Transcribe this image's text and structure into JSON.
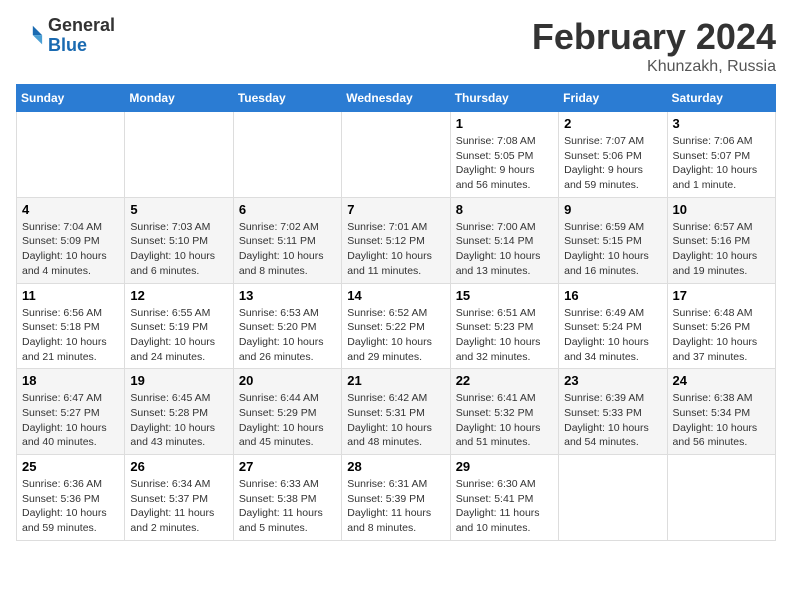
{
  "header": {
    "logo_line1": "General",
    "logo_line2": "Blue",
    "month_title": "February 2024",
    "location": "Khunzakh, Russia"
  },
  "weekdays": [
    "Sunday",
    "Monday",
    "Tuesday",
    "Wednesday",
    "Thursday",
    "Friday",
    "Saturday"
  ],
  "weeks": [
    [
      {
        "day": "",
        "info": ""
      },
      {
        "day": "",
        "info": ""
      },
      {
        "day": "",
        "info": ""
      },
      {
        "day": "",
        "info": ""
      },
      {
        "day": "1",
        "info": "Sunrise: 7:08 AM\nSunset: 5:05 PM\nDaylight: 9 hours and 56 minutes."
      },
      {
        "day": "2",
        "info": "Sunrise: 7:07 AM\nSunset: 5:06 PM\nDaylight: 9 hours and 59 minutes."
      },
      {
        "day": "3",
        "info": "Sunrise: 7:06 AM\nSunset: 5:07 PM\nDaylight: 10 hours and 1 minute."
      }
    ],
    [
      {
        "day": "4",
        "info": "Sunrise: 7:04 AM\nSunset: 5:09 PM\nDaylight: 10 hours and 4 minutes."
      },
      {
        "day": "5",
        "info": "Sunrise: 7:03 AM\nSunset: 5:10 PM\nDaylight: 10 hours and 6 minutes."
      },
      {
        "day": "6",
        "info": "Sunrise: 7:02 AM\nSunset: 5:11 PM\nDaylight: 10 hours and 8 minutes."
      },
      {
        "day": "7",
        "info": "Sunrise: 7:01 AM\nSunset: 5:12 PM\nDaylight: 10 hours and 11 minutes."
      },
      {
        "day": "8",
        "info": "Sunrise: 7:00 AM\nSunset: 5:14 PM\nDaylight: 10 hours and 13 minutes."
      },
      {
        "day": "9",
        "info": "Sunrise: 6:59 AM\nSunset: 5:15 PM\nDaylight: 10 hours and 16 minutes."
      },
      {
        "day": "10",
        "info": "Sunrise: 6:57 AM\nSunset: 5:16 PM\nDaylight: 10 hours and 19 minutes."
      }
    ],
    [
      {
        "day": "11",
        "info": "Sunrise: 6:56 AM\nSunset: 5:18 PM\nDaylight: 10 hours and 21 minutes."
      },
      {
        "day": "12",
        "info": "Sunrise: 6:55 AM\nSunset: 5:19 PM\nDaylight: 10 hours and 24 minutes."
      },
      {
        "day": "13",
        "info": "Sunrise: 6:53 AM\nSunset: 5:20 PM\nDaylight: 10 hours and 26 minutes."
      },
      {
        "day": "14",
        "info": "Sunrise: 6:52 AM\nSunset: 5:22 PM\nDaylight: 10 hours and 29 minutes."
      },
      {
        "day": "15",
        "info": "Sunrise: 6:51 AM\nSunset: 5:23 PM\nDaylight: 10 hours and 32 minutes."
      },
      {
        "day": "16",
        "info": "Sunrise: 6:49 AM\nSunset: 5:24 PM\nDaylight: 10 hours and 34 minutes."
      },
      {
        "day": "17",
        "info": "Sunrise: 6:48 AM\nSunset: 5:26 PM\nDaylight: 10 hours and 37 minutes."
      }
    ],
    [
      {
        "day": "18",
        "info": "Sunrise: 6:47 AM\nSunset: 5:27 PM\nDaylight: 10 hours and 40 minutes."
      },
      {
        "day": "19",
        "info": "Sunrise: 6:45 AM\nSunset: 5:28 PM\nDaylight: 10 hours and 43 minutes."
      },
      {
        "day": "20",
        "info": "Sunrise: 6:44 AM\nSunset: 5:29 PM\nDaylight: 10 hours and 45 minutes."
      },
      {
        "day": "21",
        "info": "Sunrise: 6:42 AM\nSunset: 5:31 PM\nDaylight: 10 hours and 48 minutes."
      },
      {
        "day": "22",
        "info": "Sunrise: 6:41 AM\nSunset: 5:32 PM\nDaylight: 10 hours and 51 minutes."
      },
      {
        "day": "23",
        "info": "Sunrise: 6:39 AM\nSunset: 5:33 PM\nDaylight: 10 hours and 54 minutes."
      },
      {
        "day": "24",
        "info": "Sunrise: 6:38 AM\nSunset: 5:34 PM\nDaylight: 10 hours and 56 minutes."
      }
    ],
    [
      {
        "day": "25",
        "info": "Sunrise: 6:36 AM\nSunset: 5:36 PM\nDaylight: 10 hours and 59 minutes."
      },
      {
        "day": "26",
        "info": "Sunrise: 6:34 AM\nSunset: 5:37 PM\nDaylight: 11 hours and 2 minutes."
      },
      {
        "day": "27",
        "info": "Sunrise: 6:33 AM\nSunset: 5:38 PM\nDaylight: 11 hours and 5 minutes."
      },
      {
        "day": "28",
        "info": "Sunrise: 6:31 AM\nSunset: 5:39 PM\nDaylight: 11 hours and 8 minutes."
      },
      {
        "day": "29",
        "info": "Sunrise: 6:30 AM\nSunset: 5:41 PM\nDaylight: 11 hours and 10 minutes."
      },
      {
        "day": "",
        "info": ""
      },
      {
        "day": "",
        "info": ""
      }
    ]
  ]
}
